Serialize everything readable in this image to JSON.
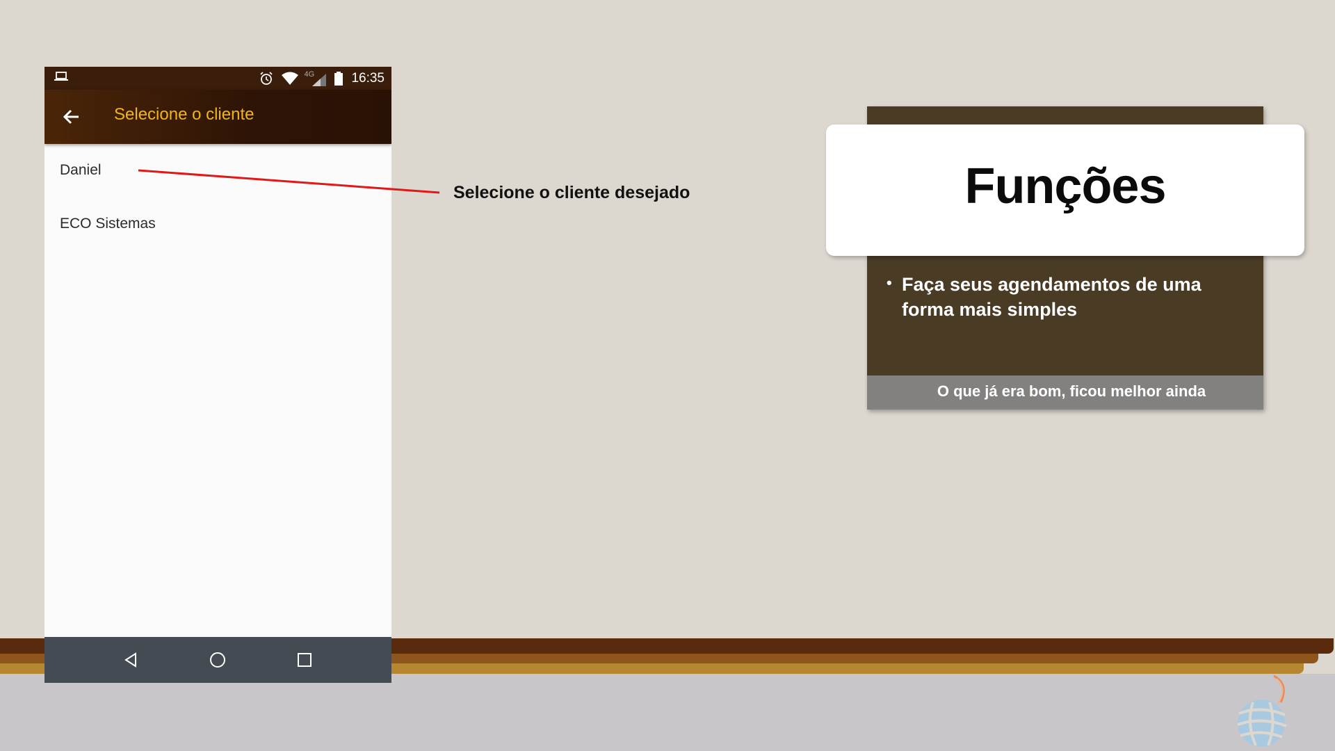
{
  "phone": {
    "status_time": "16:35",
    "network_label": "4G",
    "title": "Selecione o cliente",
    "clients": [
      "Daniel",
      "ECO Sistemas"
    ]
  },
  "annotation": "Selecione o cliente desejado",
  "card": {
    "title": "Funções",
    "bullet": "Faça seus agendamentos de uma forma mais simples",
    "footer": "O que já era bom, ficou melhor ainda"
  },
  "colors": {
    "background": "#dcd7cf",
    "appbar_title": "#f2b516",
    "card_dark": "#4a3b25",
    "annotation_line": "#e01818"
  },
  "icons": [
    "laptop-icon",
    "alarm-icon",
    "wifi-icon",
    "signal-icon",
    "battery-icon",
    "back-arrow-icon",
    "nav-back-icon",
    "nav-home-icon",
    "nav-recents-icon",
    "logo"
  ]
}
